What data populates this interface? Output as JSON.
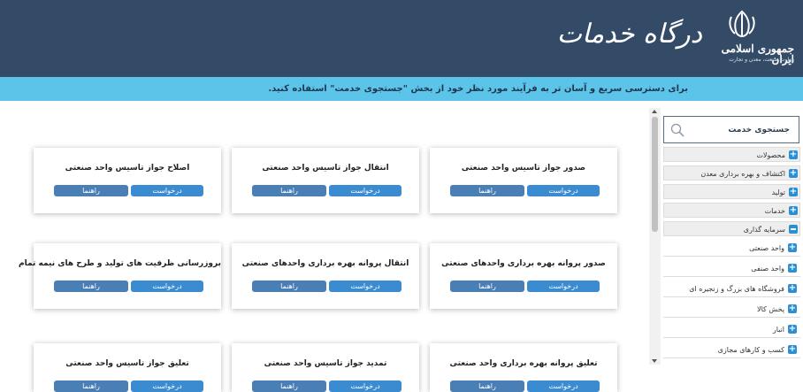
{
  "header": {
    "portal_title": "درگاه خدمات",
    "logo_title": "جمهوری اسلامی ایران",
    "logo_subtitle": "وزارت صنعت، معدن و تجارت"
  },
  "info_bar": {
    "text": "برای دسترسی سریع و آسان تر به فرآیند مورد نظر خود از بخش \"جستجوی خدمت\" استفاده کنید."
  },
  "sidebar": {
    "search_label": "جستجوی خدمت",
    "categories": [
      {
        "label": "محصولات",
        "state": "collapsed"
      },
      {
        "label": "اکتشاف و بهره برداری معدن",
        "state": "collapsed"
      },
      {
        "label": "تولید",
        "state": "collapsed"
      },
      {
        "label": "خدمات",
        "state": "collapsed"
      },
      {
        "label": "سرمایه گذاری",
        "state": "expanded"
      }
    ],
    "subitems": [
      {
        "label": "واحد صنعتی"
      },
      {
        "label": "واحد صنفی"
      },
      {
        "label": "فروشگاه های بزرگ و زنجیره ای"
      },
      {
        "label": "پخش کالا"
      },
      {
        "label": "انبار"
      },
      {
        "label": "کسب و کارهای مجازی"
      }
    ]
  },
  "buttons": {
    "request_label": "درخواست",
    "guide_label": "راهنما"
  },
  "cards": [
    {
      "title": "صدور جواز تاسیس واحد صنعتی"
    },
    {
      "title": "انتقال جواز تاسیس واحد صنعتی"
    },
    {
      "title": "اصلاح جواز تاسیس واحد صنعتی"
    },
    {
      "title": "صدور پروانه بهره برداری واحدهای صنعتی"
    },
    {
      "title": "انتقال پروانه بهره برداری واحدهای صنعتی"
    },
    {
      "title": "بروزرسانی ظرفیت های تولید و طرح های نیمه تمام"
    },
    {
      "title": "تعلیق پروانه بهره برداری واحد صنعتی"
    },
    {
      "title": "تمدید جواز تاسیس واحد صنعتی"
    },
    {
      "title": "تعلیق جواز تاسیس واحد صنعتی"
    }
  ],
  "colors": {
    "header_bg": "#344b68",
    "info_bar_bg": "#5bc4e8",
    "button_request": "#3b8bd0",
    "button_guide": "#4a7fb5",
    "icon_blue": "#2b8fd6"
  }
}
